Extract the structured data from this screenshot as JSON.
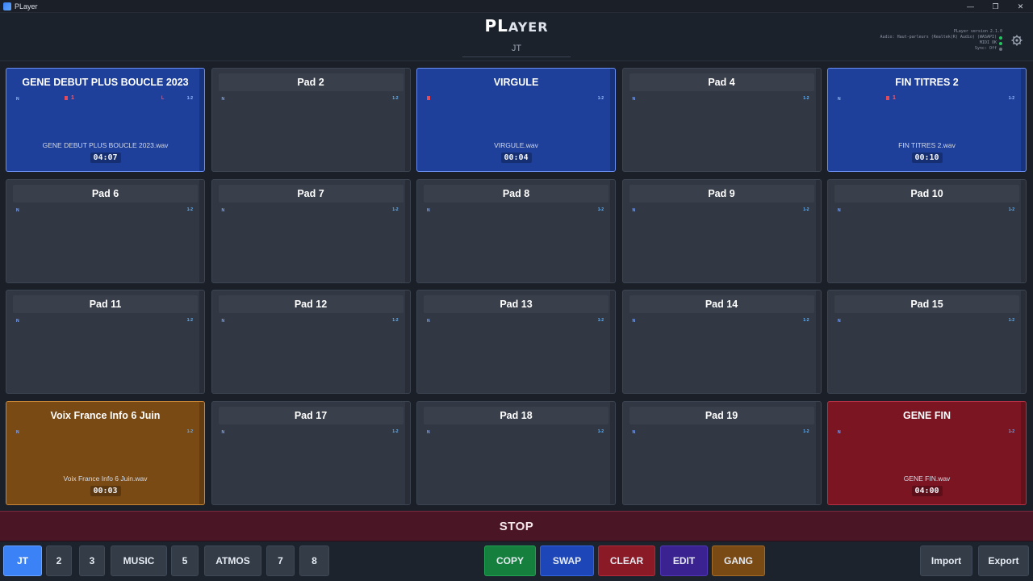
{
  "window": {
    "title": "PLayer",
    "controls": [
      "—",
      "❐",
      "✕"
    ]
  },
  "header": {
    "logo_big": "PL",
    "logo_small": "AYER",
    "bank_name": "JT",
    "status": {
      "version": "PLayer version 2.1.0",
      "audio": "Audio: Haut-parleurs (Realtek(R) Audio) (WASAPI)",
      "midi": "MIDI OK",
      "sync": "Sync: Off"
    }
  },
  "pads": [
    {
      "title": "GENE DEBUT PLUS BOUCLE 2023",
      "style": "blue",
      "file": "GENE DEBUT PLUS BOUCLE 2023.wav",
      "time": "04:07",
      "tag_left": "N",
      "tag_right": "1-2",
      "loop": "1",
      "marker": true,
      "mark_right": "L"
    },
    {
      "title": "Pad 2",
      "style": "empty",
      "tag_left": "N",
      "tag_right": "1-2"
    },
    {
      "title": "VIRGULE",
      "style": "blue",
      "file": "VIRGULE.wav",
      "time": "00:04",
      "tag_left": "",
      "tag_right": "1-2",
      "marker": true
    },
    {
      "title": "Pad 4",
      "style": "empty",
      "tag_left": "N",
      "tag_right": "1-2"
    },
    {
      "title": "FIN TITRES 2",
      "style": "blue",
      "file": "FIN TITRES 2.wav",
      "time": "00:10",
      "tag_left": "N",
      "tag_right": "1-2",
      "loop": "1",
      "marker": true
    },
    {
      "title": "Pad 6",
      "style": "empty",
      "tag_left": "N",
      "tag_right": "1-2"
    },
    {
      "title": "Pad 7",
      "style": "empty",
      "tag_left": "N",
      "tag_right": "1-2"
    },
    {
      "title": "Pad 8",
      "style": "empty",
      "tag_left": "N",
      "tag_right": "1-2"
    },
    {
      "title": "Pad 9",
      "style": "empty",
      "tag_left": "N",
      "tag_right": "1-2"
    },
    {
      "title": "Pad 10",
      "style": "empty",
      "tag_left": "N",
      "tag_right": "1-2"
    },
    {
      "title": "Pad 11",
      "style": "empty",
      "tag_left": "N",
      "tag_right": "1-2"
    },
    {
      "title": "Pad 12",
      "style": "empty",
      "tag_left": "N",
      "tag_right": "1-2"
    },
    {
      "title": "Pad 13",
      "style": "empty",
      "tag_left": "N",
      "tag_right": "1-2"
    },
    {
      "title": "Pad 14",
      "style": "empty",
      "tag_left": "N",
      "tag_right": "1-2"
    },
    {
      "title": "Pad 15",
      "style": "empty",
      "tag_left": "N",
      "tag_right": "1-2"
    },
    {
      "title": "Voix France Info 6 Juin",
      "style": "orange",
      "file": "Voix France Info 6 Juin.wav",
      "time": "00:03",
      "tag_left": "N",
      "tag_right": "1-2"
    },
    {
      "title": "Pad 17",
      "style": "empty",
      "tag_left": "N",
      "tag_right": "1-2"
    },
    {
      "title": "Pad 18",
      "style": "empty",
      "tag_left": "N",
      "tag_right": "1-2"
    },
    {
      "title": "Pad 19",
      "style": "empty",
      "tag_left": "N",
      "tag_right": "1-2"
    },
    {
      "title": "GENE FIN",
      "style": "red",
      "file": "GENE FIN.wav",
      "time": "04:00",
      "tag_left": "N",
      "tag_right": "1-2"
    }
  ],
  "stop_label": "STOP",
  "banks": [
    {
      "label": "JT",
      "active": true
    },
    {
      "label": "2"
    },
    {
      "label": "3"
    },
    {
      "label": "MUSIC"
    },
    {
      "label": "5"
    },
    {
      "label": "ATMOS"
    },
    {
      "label": "7"
    },
    {
      "label": "8"
    }
  ],
  "actions": {
    "copy": "COPY",
    "swap": "SWAP",
    "clear": "CLEAR",
    "edit": "EDIT",
    "gang": "GANG"
  },
  "file_actions": {
    "import": "Import",
    "export": "Export"
  },
  "colors": {
    "blue_pad": "#1e3f9a",
    "orange_pad": "#7a4a15",
    "red_pad": "#7c1522",
    "empty_pad": "#313844",
    "active_bank": "#3b82f6"
  }
}
